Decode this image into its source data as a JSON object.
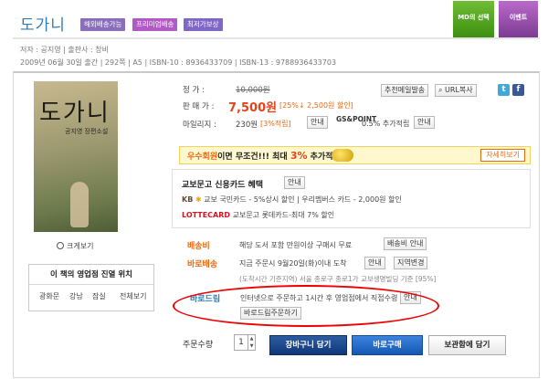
{
  "header": {
    "title": "도가니",
    "tags": [
      "해외배송가능",
      "프리미엄배송",
      "최저가보상"
    ],
    "badge_md": "MD의 선택",
    "badge_event": "이벤트"
  },
  "meta": {
    "line1": "저자 : 공지영 | 출판사 : 창비",
    "line2": "2009년 06월 30일 출간 | 292쪽 | A5 | ISBN-10 : 8936433709 | ISBN-13 : 9788936433703"
  },
  "book": {
    "cover_title": "도가니",
    "cover_sub": "공지영 장편소설",
    "zoom_label": "크게보기"
  },
  "store": {
    "header": "이 책의 영업점 진열 위치",
    "links": [
      "광화문",
      "강남",
      "잠실",
      "전체보기"
    ]
  },
  "price": {
    "list_label": "정       가 :",
    "list_value": "10,000원",
    "sale_label": "판 매 가 :",
    "sale_value": "7,500원",
    "discount": "[25%↓ 2,500원 할인]",
    "mileage_label": "마일리지 :",
    "mileage_value": "230원",
    "mileage_rate": "[3%적립]",
    "info_btn": "안내",
    "gs_point": "GS&POINT",
    "gs_rate": "0.5% 추가적립",
    "recommend_btn": "추천메일발송",
    "url_btn": "URL복사"
  },
  "member": {
    "text1": "우수회원",
    "text2": "이면 무조건!!! 최대",
    "pct": "3%",
    "text3": "추가적립",
    "more_btn": "자세히보기"
  },
  "card": {
    "header": "교보문고 신용카드 혜택",
    "info_btn": "안내",
    "line1_brand": "KB",
    "line1": "교보 국민카드 - 5%상시 할인 | 우리멤버스 카드 - 2,000원 할인",
    "line2_brand": "LOTTECARD",
    "line2": "교보문고 롯데카드-최대 7% 할인"
  },
  "shipping": {
    "fee_label": "배송비",
    "fee_text": "해당 도서 포함 만원이상 구매시 무료",
    "fee_btn": "배송비 안내",
    "fast_label": "바로배송",
    "fast_text": "지금 주문시 9월20일(화)이내 도착",
    "fast_info_btn": "안내",
    "region_btn": "지역변경",
    "fast_note": "(도착시간 기준지역) 서울 종로구 종로1가 교보생명빌딩 기준 [95%]",
    "drum_label": "바로드림",
    "drum_text": "인터넷으로 주문하고 1시간 후 영업점에서 직접수령",
    "drum_info_btn": "안내",
    "drum_order_btn": "바로드림주문하기"
  },
  "order": {
    "qty_label": "주문수량",
    "qty_value": "1",
    "cart_btn": "장바구니 담기",
    "buy_btn": "바로구매",
    "wish_btn": "보관함에 담기"
  },
  "colors": {
    "accent_blue": "#2f7cb4",
    "price_red": "#e5441b",
    "label_orange": "#e86a12"
  }
}
